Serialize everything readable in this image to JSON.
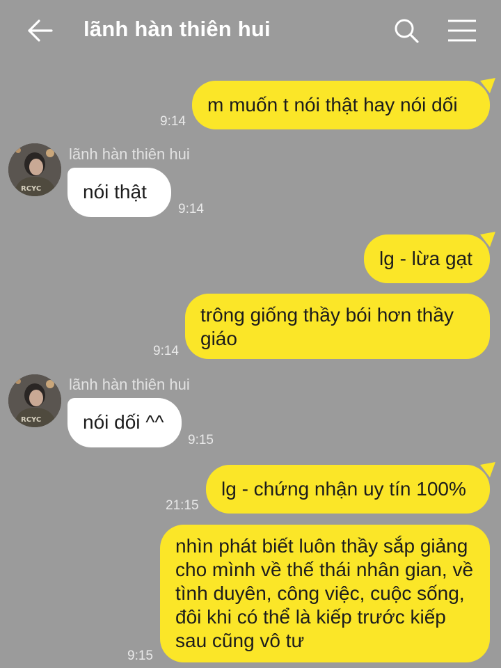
{
  "header": {
    "title": "lãnh hàn thiên hui",
    "back_icon": "arrow-left-icon",
    "search_icon": "search-icon",
    "menu_icon": "hamburger-menu-icon"
  },
  "colors": {
    "background": "#9b9b9b",
    "outgoing_bubble": "#fbe628",
    "incoming_bubble": "#ffffff"
  },
  "messages": [
    {
      "direction": "out",
      "text": "m muốn t nói thật hay nói dối",
      "time": "9:14"
    },
    {
      "direction": "in",
      "sender": "lãnh hàn thiên hui",
      "text": "nói thật",
      "time": "9:14"
    },
    {
      "direction": "out",
      "text": "lg - lừa gạt",
      "time": ""
    },
    {
      "direction": "out",
      "text": "trông giống thầy bói hơn thầy giáo",
      "time": "9:14"
    },
    {
      "direction": "in",
      "sender": "lãnh hàn thiên hui",
      "text": "nói dối ^^",
      "time": "9:15"
    },
    {
      "direction": "out",
      "text": "lg - chứng nhận uy tín 100%",
      "time": "21:15"
    },
    {
      "direction": "out",
      "text": "nhìn phát biết luôn thầy sắp giảng cho mình về thế thái nhân gian, về tình duyên, công việc, cuộc sống, đôi khi có thể là kiếp trước kiếp sau cũng vô tư",
      "time": "9:15"
    }
  ]
}
